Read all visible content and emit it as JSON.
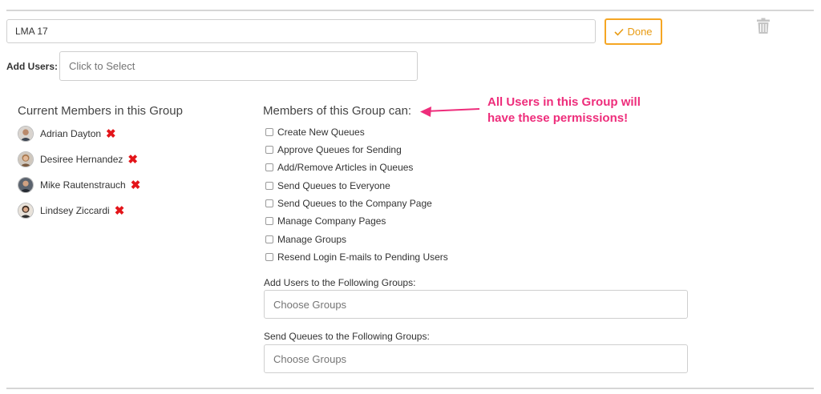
{
  "group": {
    "name_value": "LMA 17",
    "done_label": "Done",
    "add_users_label": "Add Users:",
    "add_users_placeholder": "Click to Select"
  },
  "members": {
    "heading": "Current Members in this Group",
    "items": [
      {
        "name": "Adrian Dayton"
      },
      {
        "name": "Desiree Hernandez"
      },
      {
        "name": "Mike Rautenstrauch"
      },
      {
        "name": "Lindsey Ziccardi"
      }
    ]
  },
  "permissions": {
    "heading": "Members of this Group can:",
    "items": [
      {
        "label": "Create New Queues",
        "checked": false
      },
      {
        "label": "Approve Queues for Sending",
        "checked": false
      },
      {
        "label": "Add/Remove Articles in Queues",
        "checked": false
      },
      {
        "label": "Send Queues to Everyone",
        "checked": false
      },
      {
        "label": "Send Queues to the Company Page",
        "checked": false
      },
      {
        "label": "Manage Company Pages",
        "checked": false
      },
      {
        "label": "Manage Groups",
        "checked": false
      },
      {
        "label": "Resend Login E-mails to Pending Users",
        "checked": false
      }
    ]
  },
  "add_to_groups": {
    "label": "Add Users to the Following Groups:",
    "placeholder": "Choose Groups"
  },
  "send_queues_groups": {
    "label": "Send Queues to the Following Groups:",
    "placeholder": "Choose Groups"
  },
  "annotation": {
    "line1": "All Users in this Group will",
    "line2": "have these permissions!"
  },
  "colors": {
    "accent": "#f5a623",
    "remove": "#e3151a",
    "annotation": "#ee2d7b"
  },
  "icons": {
    "done": "check-icon",
    "delete": "trash-icon",
    "remove": "x-icon",
    "pointer": "arrow-left-icon"
  }
}
